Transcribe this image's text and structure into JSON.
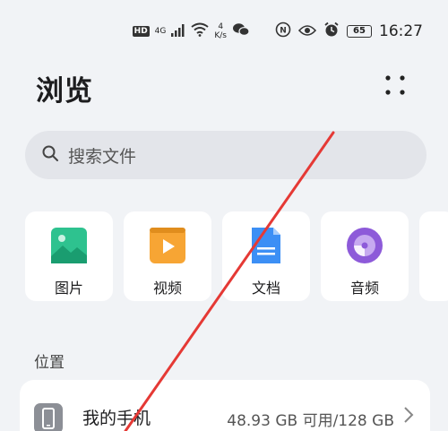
{
  "status_bar": {
    "hd": "HD",
    "signal_gen": "4G",
    "speed_value": "4",
    "speed_unit": "K/s",
    "battery": "65",
    "time": "16:27"
  },
  "header": {
    "title": "浏览"
  },
  "search": {
    "placeholder": "搜索文件"
  },
  "categories": [
    {
      "label": "图片",
      "icon": "image-icon",
      "color": "#2ec28f"
    },
    {
      "label": "视频",
      "icon": "video-icon",
      "color": "#f7a534"
    },
    {
      "label": "文档",
      "icon": "document-icon",
      "color": "#3c8ff5"
    },
    {
      "label": "音频",
      "icon": "audio-icon",
      "color": "#8d5ad9"
    }
  ],
  "locations": {
    "title": "位置",
    "items": [
      {
        "name": "我的手机",
        "space": "48.93 GB 可用/128 GB"
      }
    ]
  },
  "colors": {
    "background": "#f1f3f6",
    "card": "#ffffff",
    "annotation_arrow": "#e53935"
  }
}
